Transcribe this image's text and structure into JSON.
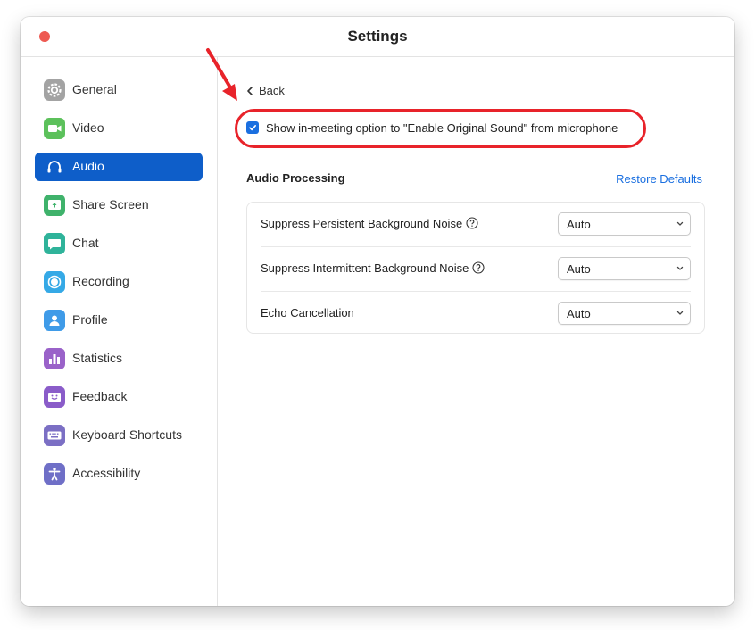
{
  "window": {
    "title": "Settings"
  },
  "sidebar": {
    "items": [
      {
        "label": "General",
        "icon": "gear-icon",
        "color": "#9e9e9e",
        "active": false
      },
      {
        "label": "Video",
        "icon": "video-camera-icon",
        "color": "#5cc15b",
        "active": false
      },
      {
        "label": "Audio",
        "icon": "headphones-icon",
        "color": "#0e5ec9",
        "active": true
      },
      {
        "label": "Share Screen",
        "icon": "share-screen-icon",
        "color": "#3fb26b",
        "active": false
      },
      {
        "label": "Chat",
        "icon": "chat-bubble-icon",
        "color": "#2fb39a",
        "active": false
      },
      {
        "label": "Recording",
        "icon": "record-icon",
        "color": "#35a9e6",
        "active": false
      },
      {
        "label": "Profile",
        "icon": "person-icon",
        "color": "#3f9be8",
        "active": false
      },
      {
        "label": "Statistics",
        "icon": "bar-chart-icon",
        "color": "#9a62c9",
        "active": false
      },
      {
        "label": "Feedback",
        "icon": "smiley-icon",
        "color": "#8a5cc9",
        "active": false
      },
      {
        "label": "Keyboard Shortcuts",
        "icon": "keyboard-icon",
        "color": "#7b6fc4",
        "active": false
      },
      {
        "label": "Accessibility",
        "icon": "accessibility-icon",
        "color": "#6f6fc7",
        "active": false
      }
    ]
  },
  "main": {
    "back_label": "Back",
    "original_sound_option": {
      "label": "Show in-meeting option to \"Enable Original Sound\" from microphone",
      "checked": true
    },
    "audio_processing": {
      "title": "Audio Processing",
      "restore_label": "Restore Defaults",
      "rows": [
        {
          "label": "Suppress Persistent Background Noise",
          "has_help": true,
          "value": "Auto"
        },
        {
          "label": "Suppress Intermittent Background Noise",
          "has_help": true,
          "value": "Auto"
        },
        {
          "label": "Echo Cancellation",
          "has_help": false,
          "value": "Auto"
        }
      ]
    }
  },
  "colors": {
    "accent": "#0e5ec9",
    "link": "#1a6fe0",
    "annotation": "#e8232a",
    "close_button": "#ee5a52"
  }
}
